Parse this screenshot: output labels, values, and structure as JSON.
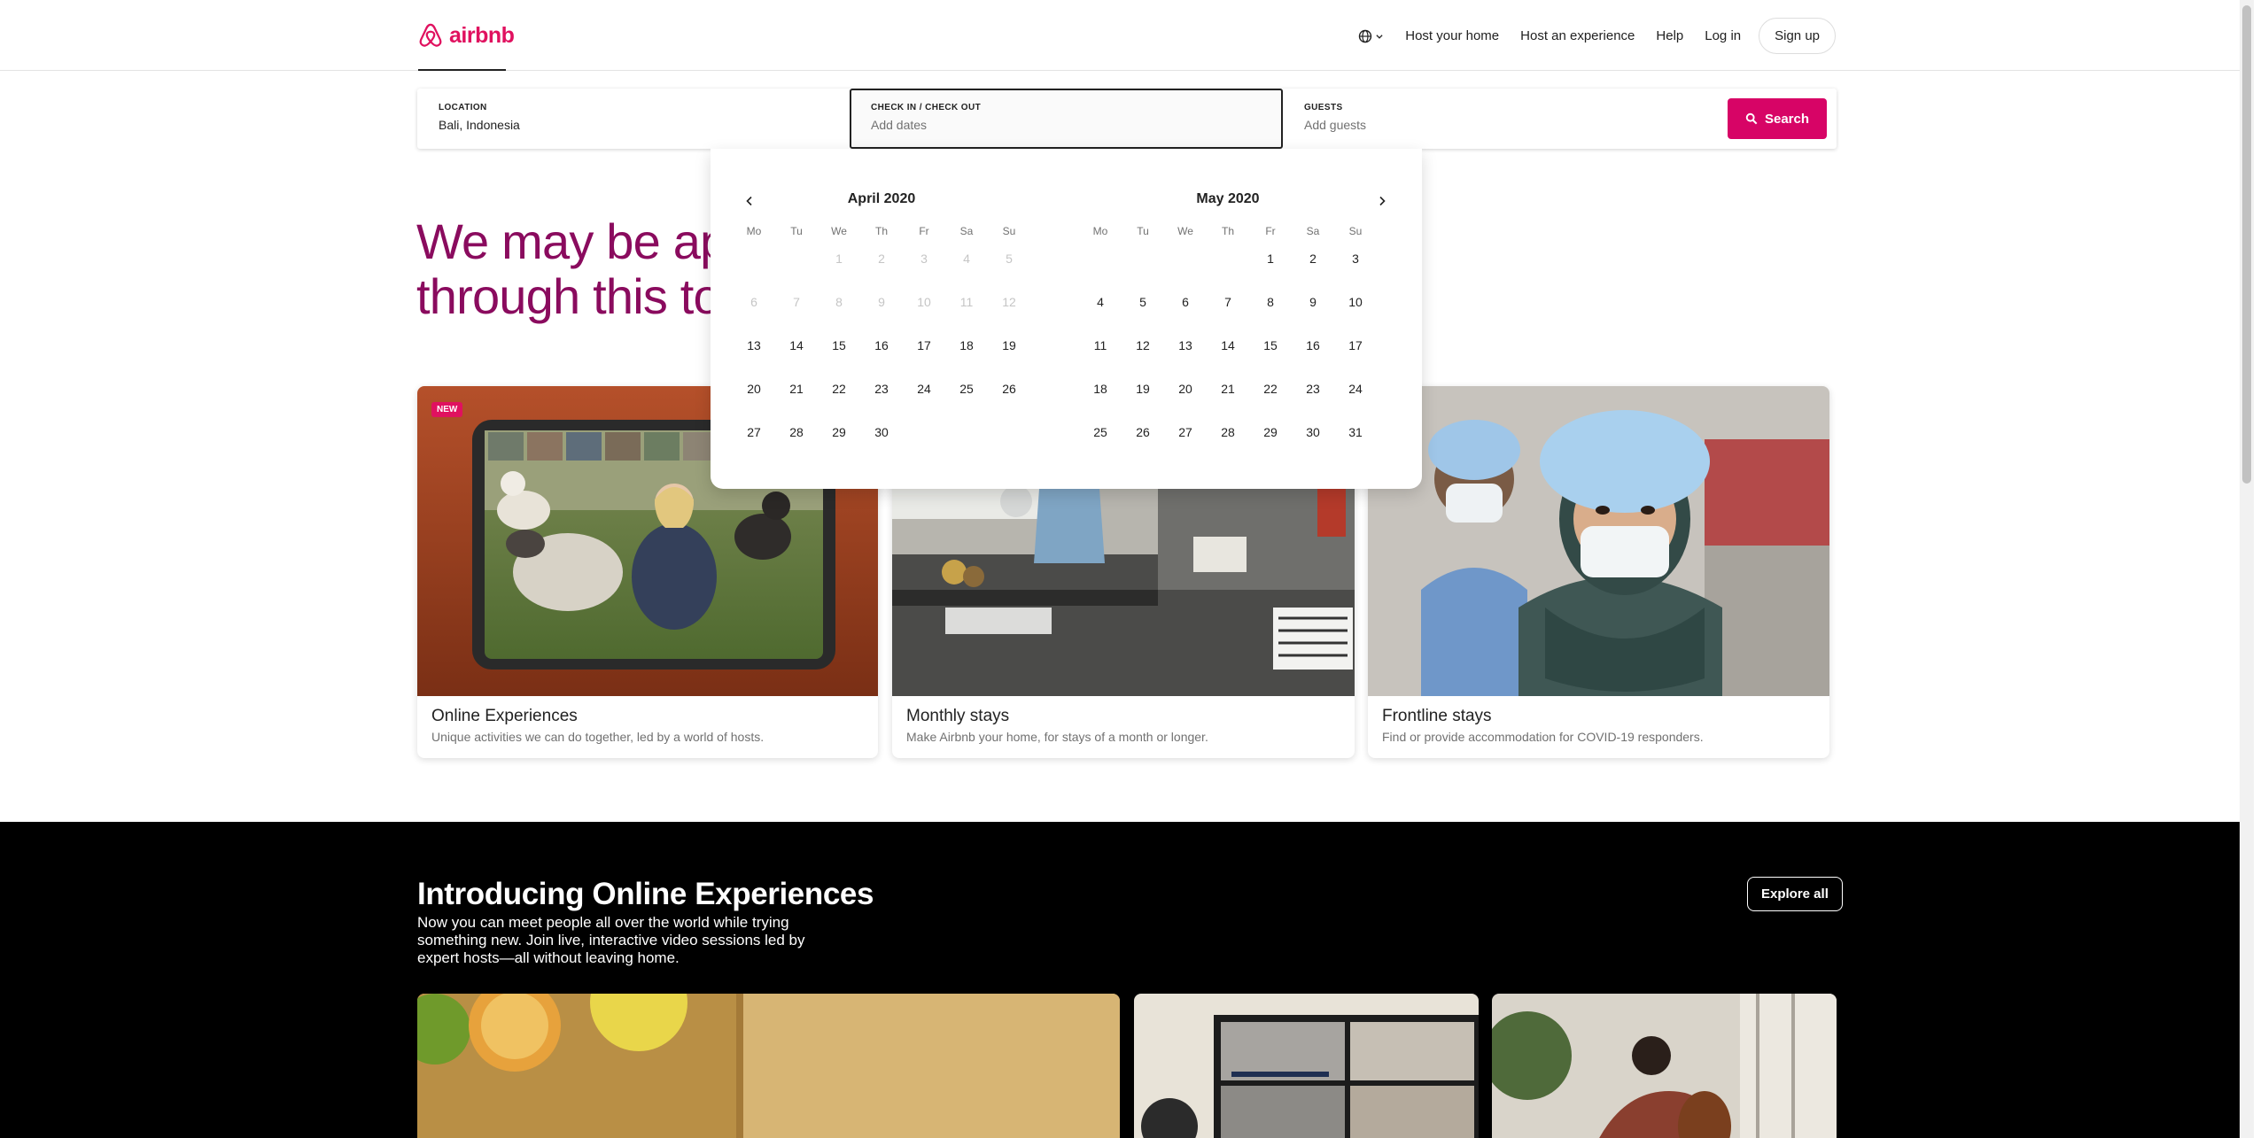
{
  "header": {
    "brand": "airbnb",
    "nav": {
      "host_home": "Host your home",
      "host_experience": "Host an experience",
      "help": "Help",
      "login": "Log in",
      "signup": "Sign up"
    }
  },
  "search": {
    "location_label": "LOCATION",
    "location_value": "Bali, Indonesia",
    "dates_label": "CHECK IN / CHECK OUT",
    "dates_placeholder": "Add dates",
    "guests_label": "GUESTS",
    "guests_placeholder": "Add guests",
    "button": "Search"
  },
  "hero": {
    "line1": "We may be apa",
    "line2": "through this tog"
  },
  "calendar": {
    "weekdays": [
      "Mo",
      "Tu",
      "We",
      "Th",
      "Fr",
      "Sa",
      "Su"
    ],
    "months": [
      {
        "title": "April 2020",
        "leading_blanks": 2,
        "days": 30,
        "past_until": 12
      },
      {
        "title": "May 2020",
        "leading_blanks": 4,
        "days": 31,
        "past_until": 0
      }
    ]
  },
  "cards": [
    {
      "title": "Online Experiences",
      "subtitle": "Unique activities we can do together, led by a world of hosts.",
      "badge": "NEW"
    },
    {
      "title": "Monthly stays",
      "subtitle": "Make Airbnb your home, for stays of a month or longer."
    },
    {
      "title": "Frontline stays",
      "subtitle": "Find or provide accommodation for COVID-19 responders."
    }
  ],
  "online_experiences": {
    "title": "Introducing Online Experiences",
    "description": "Now you can meet people all over the world while trying something new. Join live, interactive video sessions led by expert hosts—all without leaving home.",
    "button": "Explore all"
  },
  "colors": {
    "brand": "#e0115f",
    "search_button": "#d70466",
    "hero_text": "#8a0b5e"
  }
}
